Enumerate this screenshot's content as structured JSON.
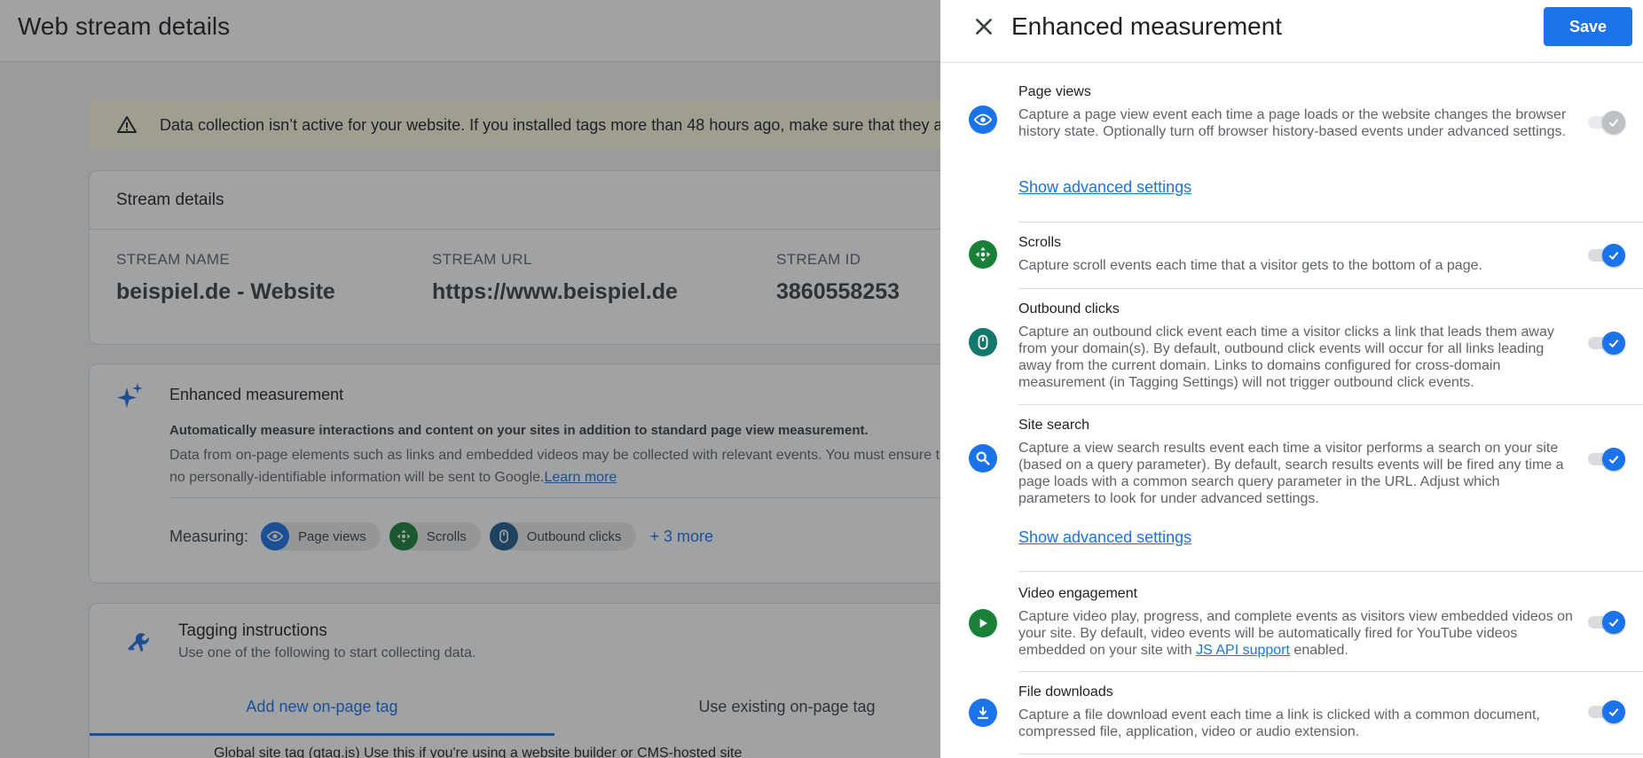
{
  "page": {
    "title": "Web stream details",
    "warning": "Data collection isn’t active for your website. If you installed tags more than 48 hours ago, make sure that they are set up correctly."
  },
  "stream_details": {
    "title": "Stream details",
    "fields": [
      {
        "label": "STREAM NAME",
        "value": "beispiel.de - Website"
      },
      {
        "label": "STREAM URL",
        "value": "https://www.beispiel.de"
      },
      {
        "label": "STREAM ID",
        "value": "3860558253"
      }
    ]
  },
  "enhanced_card": {
    "title": "Enhanced measurement",
    "bold_text": "Automatically measure interactions and content on your sites in addition to standard page view measurement.",
    "desc": "Data from on-page elements such as links and embedded videos may be collected with relevant events. You must ensure that no personally-identifiable information will be sent to Google.",
    "learn_more": "Learn more",
    "measuring_label": "Measuring:",
    "chips": [
      {
        "label": "Page views",
        "icon": "eye-icon"
      },
      {
        "label": "Scrolls",
        "icon": "scroll-icon"
      },
      {
        "label": "Outbound clicks",
        "icon": "mouse-icon"
      }
    ],
    "more": "+ 3 more"
  },
  "tagging": {
    "title": "Tagging instructions",
    "subtitle": "Use one of the following to start collecting data.",
    "tabs": [
      "Add new on-page tag",
      "Use existing on-page tag"
    ],
    "row_title": "Global site tag (gtag.js)",
    "row_desc": "Use this if you're using a website builder or CMS-hosted site"
  },
  "panel": {
    "title": "Enhanced measurement",
    "save_label": "Save",
    "items": [
      {
        "title": "Page views",
        "desc": "Capture a page view event each time a page loads or the website changes the browser history state. Optionally turn off browser history-based events under advanced settings.",
        "link": "Show advanced settings",
        "enabled": true,
        "disabled": true,
        "icon": "eye-icon",
        "color": "#1a73e8"
      },
      {
        "title": "Scrolls",
        "desc": "Capture scroll events each time that a visitor gets to the bottom of a page.",
        "enabled": true,
        "icon": "scroll-icon",
        "color": "#188038"
      },
      {
        "title": "Outbound clicks",
        "desc": "Capture an outbound click event each time a visitor clicks a link that leads them away from your domain(s). By default, outbound click events will occur for all links leading away from the current domain. Links to domains configured for cross-domain measurement (in Tagging Settings) will not trigger outbound click events.",
        "enabled": true,
        "icon": "mouse-icon",
        "color": "#12776d"
      },
      {
        "title": "Site search",
        "desc": "Capture a view search results event each time a visitor performs a search on your site (based on a query parameter). By default, search results events will be fired any time a page loads with a common search query parameter in the URL. Adjust which parameters to look for under advanced settings.",
        "link": "Show advanced settings",
        "enabled": true,
        "icon": "search-icon",
        "color": "#1a73e8"
      },
      {
        "title": "Video engagement",
        "desc_before": "Capture video play, progress, and complete events as visitors view embedded videos on your site. By default, video events will be automatically fired for YouTube videos embedded on your site with ",
        "desc_link": "JS API support",
        "desc_after": " enabled.",
        "enabled": true,
        "icon": "play-icon",
        "color": "#188038"
      },
      {
        "title": "File downloads",
        "desc": "Capture a file download event each time a link is clicked with a common document, compressed file, application, video or audio extension.",
        "enabled": true,
        "icon": "download-icon",
        "color": "#1a73e8"
      }
    ]
  }
}
